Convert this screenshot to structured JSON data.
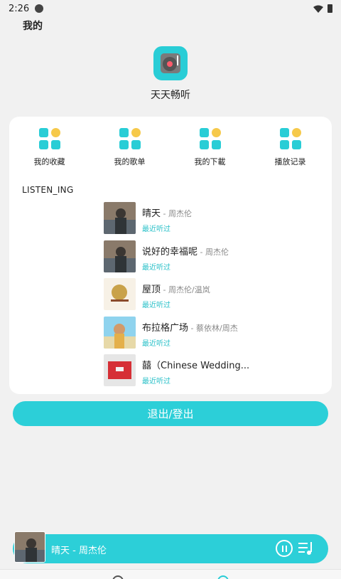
{
  "status": {
    "time": "2:26"
  },
  "header": {
    "title": "我的"
  },
  "profile": {
    "app_name": "天天畅听"
  },
  "quick_actions": [
    {
      "label": "我的收藏"
    },
    {
      "label": "我的歌单"
    },
    {
      "label": "我的下載"
    },
    {
      "label": "播放记录"
    }
  ],
  "listening": {
    "title": "LISTEN_ING",
    "songs": [
      {
        "name": "晴天",
        "sep": " - ",
        "artist": "周杰伦",
        "tag": "最近听过"
      },
      {
        "name": "说好的幸福呢",
        "sep": " - ",
        "artist": "周杰伦",
        "tag": "最近听过"
      },
      {
        "name": "屋顶",
        "sep": " - ",
        "artist": "周杰伦/温岚",
        "tag": "最近听过"
      },
      {
        "name": "布拉格广场",
        "sep": " - ",
        "artist": "蔡依林/周杰",
        "tag": "最近听过"
      },
      {
        "name": "囍（Chinese Wedding...",
        "sep": "",
        "artist": "",
        "tag": "最近听过"
      }
    ]
  },
  "logout_label": "退出/登出",
  "player": {
    "now_playing": "晴天 - 周杰伦"
  },
  "colors": {
    "accent": "#2ccfd8",
    "highlight": "#f6c94a"
  }
}
